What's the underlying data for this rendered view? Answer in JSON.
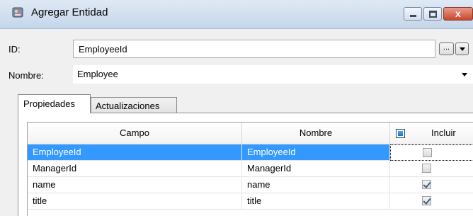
{
  "window": {
    "title": "Agregar Entidad",
    "close_glyph": "x"
  },
  "id_field": {
    "label": "ID:",
    "value": "EmployeeId",
    "ellipsis": "..."
  },
  "name_field": {
    "label": "Nombre:",
    "value": "Employee"
  },
  "tabs": [
    {
      "label": "Propiedades",
      "active": true
    },
    {
      "label": "Actualizaciones",
      "active": false
    }
  ],
  "grid": {
    "columns": {
      "campo": "Campo",
      "nombre": "Nombre",
      "incluir": "Incluir"
    },
    "rows": [
      {
        "campo": "EmployeeId",
        "nombre": "EmployeeId",
        "incluir": false,
        "selected": true
      },
      {
        "campo": "ManagerId",
        "nombre": "ManagerId",
        "incluir": false,
        "selected": false
      },
      {
        "campo": "name",
        "nombre": "name",
        "incluir": true,
        "selected": false
      },
      {
        "campo": "title",
        "nombre": "title",
        "incluir": true,
        "selected": false
      }
    ]
  },
  "colors": {
    "selection": "#3399ff",
    "titlebar": "#c5d6ea",
    "close_button": "#c9462c"
  }
}
